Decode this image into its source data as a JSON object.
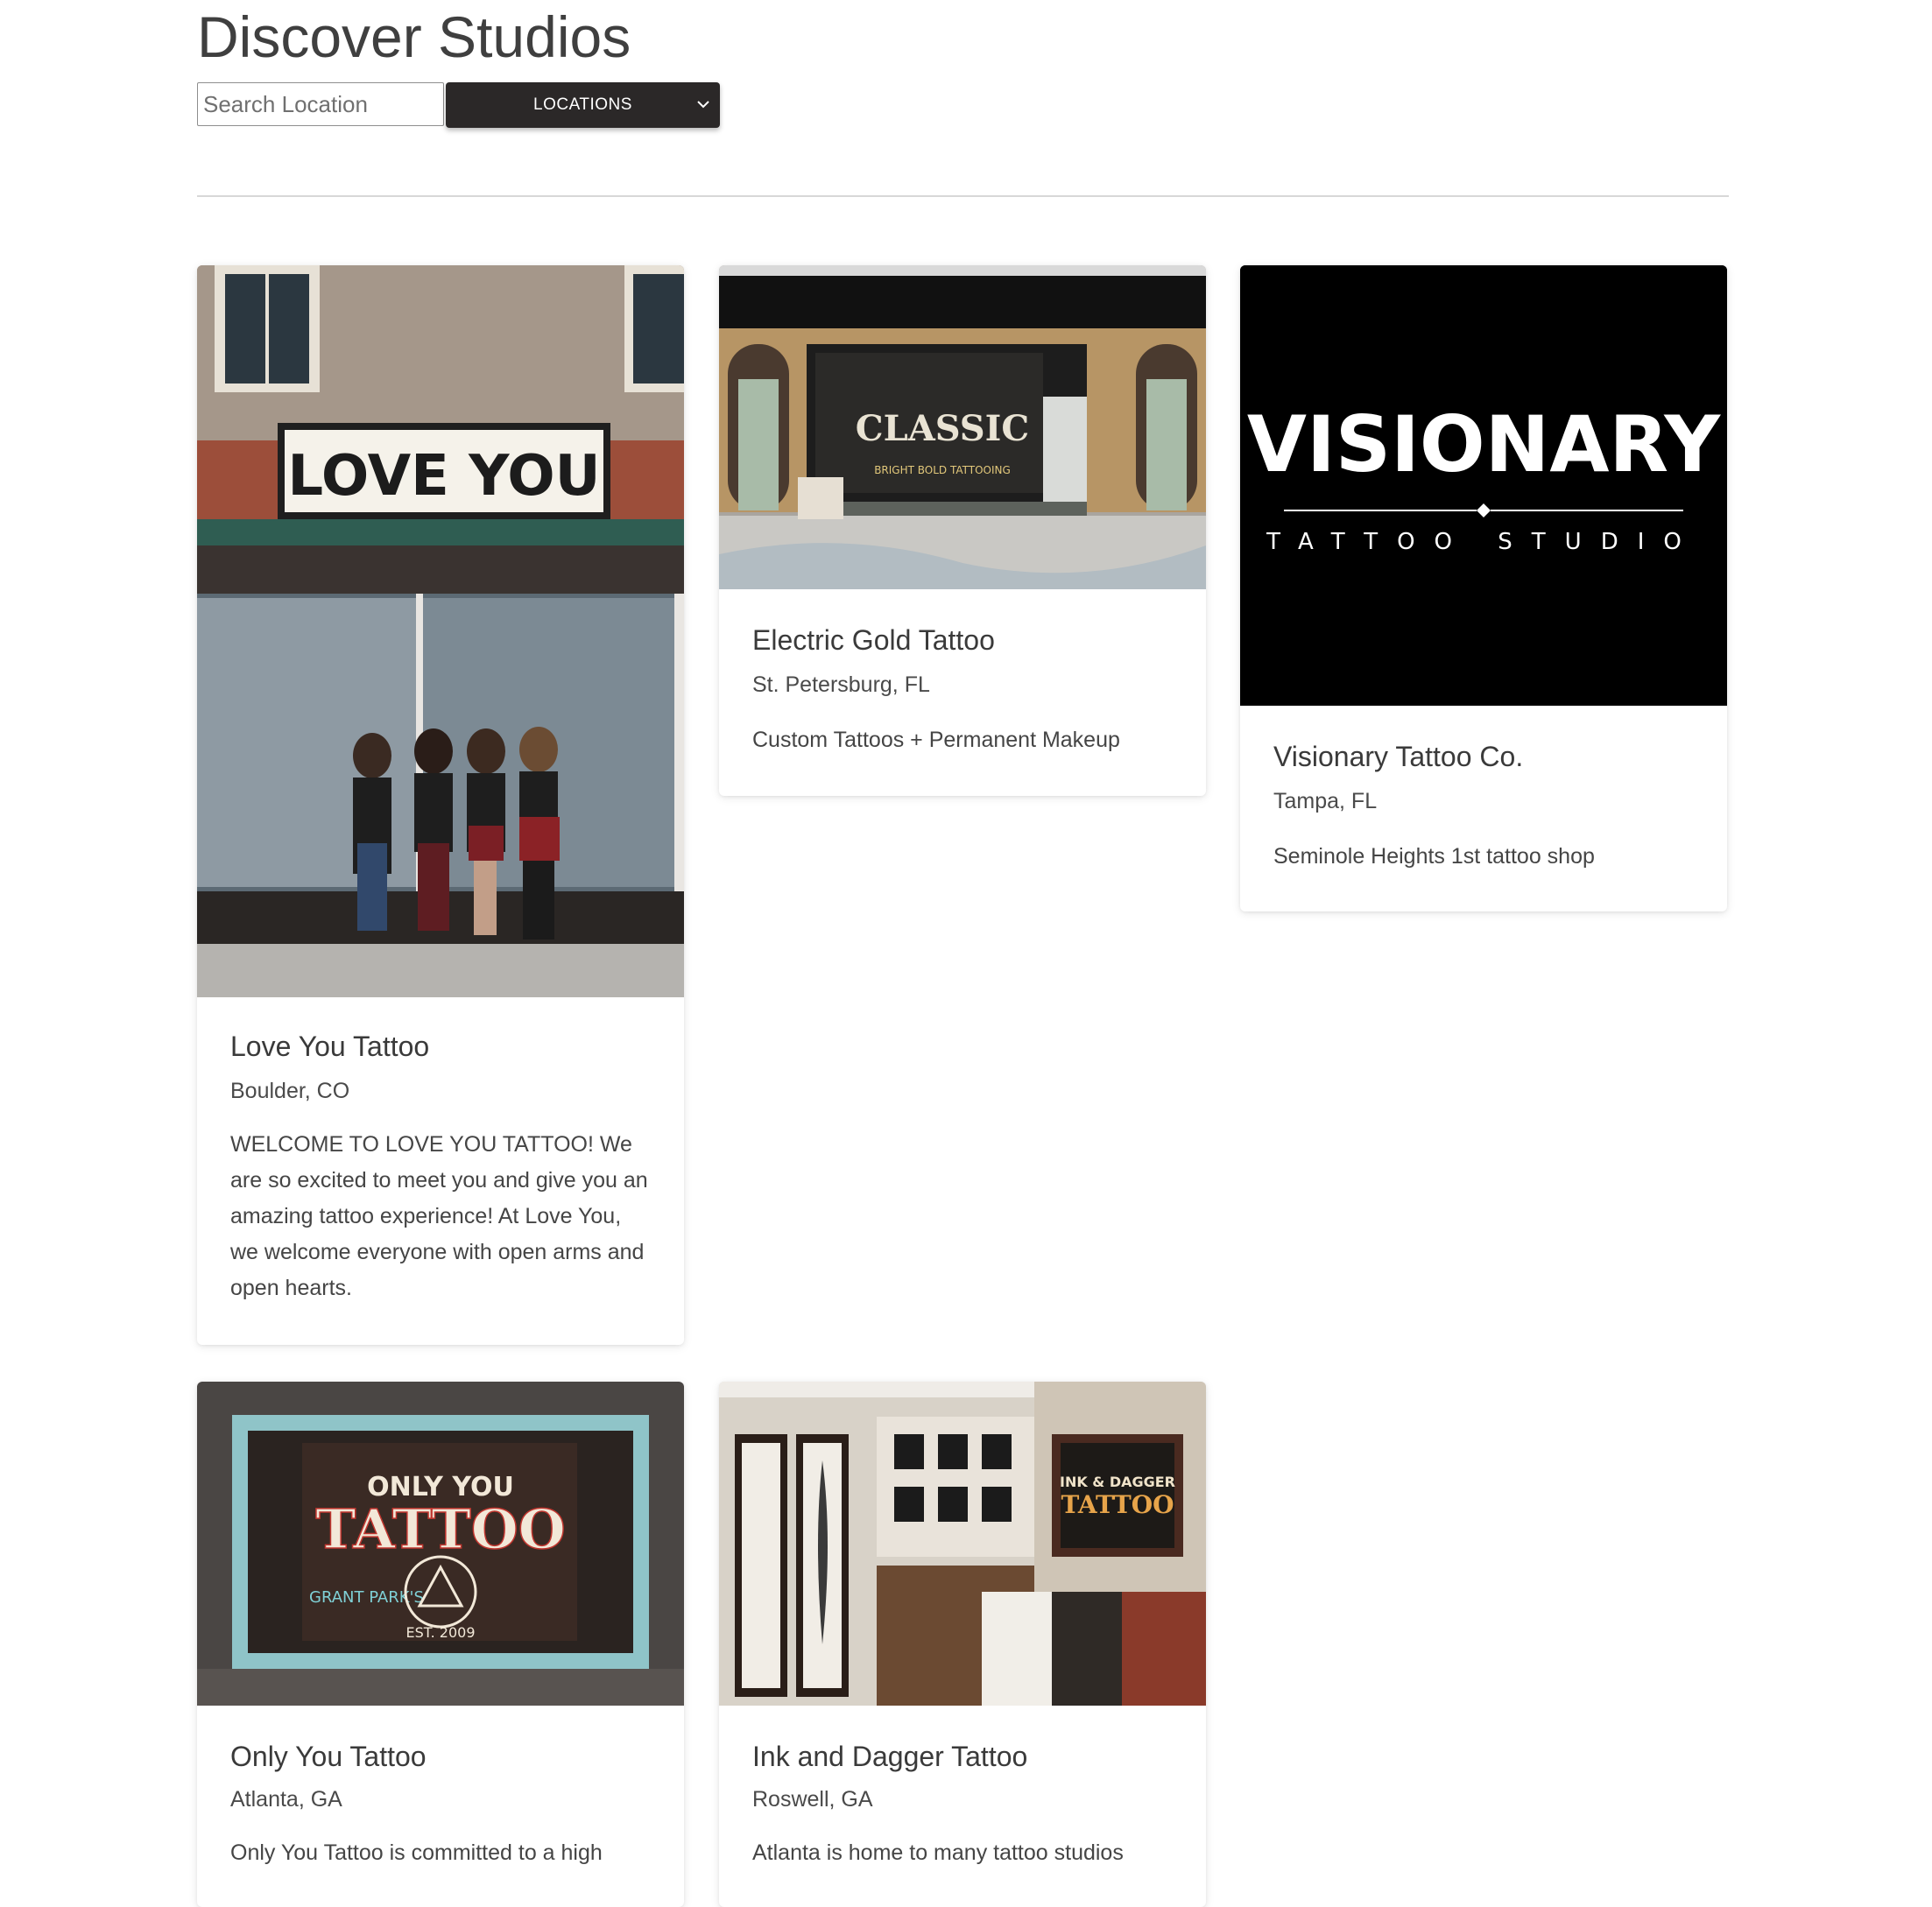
{
  "page": {
    "title": "Discover Studios"
  },
  "search": {
    "placeholder": "Search Location"
  },
  "filter": {
    "label": "LOCATIONS",
    "icon": "chevron-down-icon"
  },
  "studios": [
    {
      "name": "Love You Tattoo",
      "location": "Boulder, CO",
      "description": "WELCOME TO LOVE YOU TATTOO! We are so excited to meet you and give you an amazing tattoo experience! At Love You, we welcome everyone with open arms and open hearts.",
      "sign_text": "LOVE YOU"
    },
    {
      "name": "Electric Gold Tattoo",
      "location": "St. Petersburg, FL",
      "description": "Custom Tattoos + Permanent Makeup",
      "sign_text": "CLASSIC",
      "sign_sub": "BRIGHT BOLD  TATTOOING"
    },
    {
      "name": "Visionary Tattoo Co.",
      "location": "Tampa, FL",
      "description": "Seminole Heights 1st tattoo shop",
      "logo_text": "VISIONARY",
      "logo_sub": "TATTOO STUDIO"
    },
    {
      "name": "Only You Tattoo",
      "location": "Atlanta, GA",
      "description": "Only You Tattoo is committed to a high",
      "sign_text": "TATTOO",
      "sign_top": "ONLY YOU",
      "sign_left": "GRANT PARK'S",
      "sign_est": "EST. 2009"
    },
    {
      "name": "Ink and Dagger Tattoo",
      "location": "Roswell, GA",
      "description": "Atlanta is home to many tattoo studios",
      "sign_text": "INK & DAGGER",
      "sign_sub": "TATTOO"
    }
  ],
  "colors": {
    "dropdown_bg": "#2b2828",
    "text": "#3d3d3d",
    "divider": "#d7d7d7"
  }
}
